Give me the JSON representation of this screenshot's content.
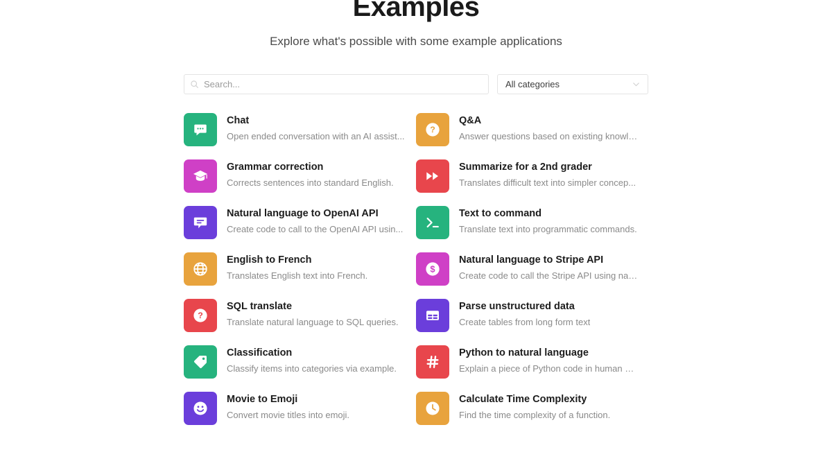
{
  "header": {
    "title": "Examples",
    "subtitle": "Explore what's possible with some example applications"
  },
  "search": {
    "placeholder": "Search...",
    "value": "",
    "icon": "search-icon"
  },
  "category_filter": {
    "selected": "All categories",
    "icon": "chevron-down-icon"
  },
  "colors": {
    "green": "#26b37e",
    "orange": "#e8a33d",
    "magenta": "#cf40c6",
    "red": "#e8464c",
    "purple": "#6b3edb",
    "title": "#1c1c1c",
    "description": "#8a8a8a"
  },
  "cards": [
    {
      "title": "Chat",
      "description": "Open ended conversation with an AI assist...",
      "color": "#26b37e",
      "icon": "chat-bubble-icon"
    },
    {
      "title": "Q&A",
      "description": "Answer questions based on existing knowle...",
      "color": "#e8a33d",
      "icon": "question-circle-icon"
    },
    {
      "title": "Grammar correction",
      "description": "Corrects sentences into standard English.",
      "color": "#cf40c6",
      "icon": "graduation-cap-icon"
    },
    {
      "title": "Summarize for a 2nd grader",
      "description": "Translates difficult text into simpler concep...",
      "color": "#e8464c",
      "icon": "fast-forward-icon"
    },
    {
      "title": "Natural language to OpenAI API",
      "description": "Create code to call to the OpenAI API usin...",
      "color": "#6b3edb",
      "icon": "comment-lines-icon"
    },
    {
      "title": "Text to command",
      "description": "Translate text into programmatic commands.",
      "color": "#26b37e",
      "icon": "terminal-icon"
    },
    {
      "title": "English to French",
      "description": "Translates English text into French.",
      "color": "#e8a33d",
      "icon": "globe-icon"
    },
    {
      "title": "Natural language to Stripe API",
      "description": "Create code to call the Stripe API using nat...",
      "color": "#cf40c6",
      "icon": "dollar-circle-icon"
    },
    {
      "title": "SQL translate",
      "description": "Translate natural language to SQL queries.",
      "color": "#e8464c",
      "icon": "question-circle-icon"
    },
    {
      "title": "Parse unstructured data",
      "description": "Create tables from long form text",
      "color": "#6b3edb",
      "icon": "table-icon"
    },
    {
      "title": "Classification",
      "description": "Classify items into categories via example.",
      "color": "#26b37e",
      "icon": "tag-icon"
    },
    {
      "title": "Python to natural language",
      "description": "Explain a piece of Python code in human un...",
      "color": "#e8464c",
      "icon": "hash-icon"
    },
    {
      "title": "Movie to Emoji",
      "description": "Convert movie titles into emoji.",
      "color": "#6b3edb",
      "icon": "smiley-face-icon"
    },
    {
      "title": "Calculate Time Complexity",
      "description": "Find the time complexity of a function.",
      "color": "#e8a33d",
      "icon": "clock-icon"
    }
  ]
}
